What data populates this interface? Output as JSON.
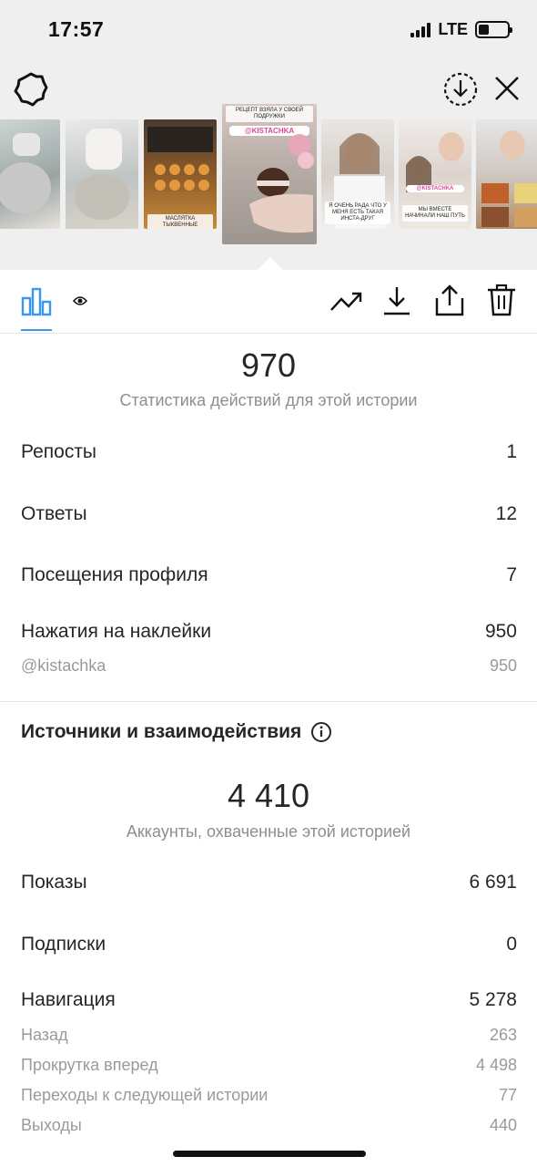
{
  "status_bar": {
    "time": "17:57",
    "network": "LTE",
    "battery_level": 0.35
  },
  "header": {
    "icons": [
      "settings-icon",
      "download-circle-icon",
      "close-icon"
    ]
  },
  "stories": [
    {
      "caption": ""
    },
    {
      "caption": ""
    },
    {
      "caption": "МАСЛЯТКА ТЫКВЕННЫЕ"
    },
    {
      "caption": "РЕЦЕПТ ВЗЯЛА У СВОЕЙ ПОДРУЖКИ",
      "mention": "@KISTACHKA",
      "selected": true
    },
    {
      "caption": "Я ОЧЕНЬ РАДА ЧТО У МЕНЯ ЕСТЬ ТАКАЯ ИНСТА-ДРУГ"
    },
    {
      "caption": "МЫ ВМЕСТЕ НАЧИНАЛИ НАШ ПУТЬ",
      "mention": "@KISTACHKA"
    },
    {
      "caption": ""
    }
  ],
  "tabs": {
    "icons": [
      "bar-chart-icon",
      "eye-icon",
      "trending-icon",
      "download-icon",
      "share-icon",
      "trash-icon"
    ]
  },
  "actions": {
    "total": "970",
    "subtitle": "Статистика действий для этой истории",
    "rows": [
      {
        "label": "Репосты",
        "value": "1"
      },
      {
        "label": "Ответы",
        "value": "12"
      },
      {
        "label": "Посещения профиля",
        "value": "7"
      },
      {
        "label": "Нажатия на наклейки",
        "value": "950"
      }
    ],
    "sticker": {
      "label": "@kistachka",
      "value": "950"
    }
  },
  "discovery": {
    "title": "Источники и взаимодействия",
    "total": "4 410",
    "subtitle": "Аккаунты, охваченные этой историей",
    "rows": [
      {
        "label": "Показы",
        "value": "6 691"
      },
      {
        "label": "Подписки",
        "value": "0"
      },
      {
        "label": "Навигация",
        "value": "5 278"
      }
    ],
    "navigation": [
      {
        "label": "Назад",
        "value": "263"
      },
      {
        "label": "Прокрутка вперед",
        "value": "4 498"
      },
      {
        "label": "Переходы к следующей истории",
        "value": "77"
      },
      {
        "label": "Выходы",
        "value": "440"
      }
    ]
  },
  "colors": {
    "accent": "#3897f0",
    "text": "#262626",
    "muted": "#8e8e8e",
    "header_bg": "#efefef"
  }
}
